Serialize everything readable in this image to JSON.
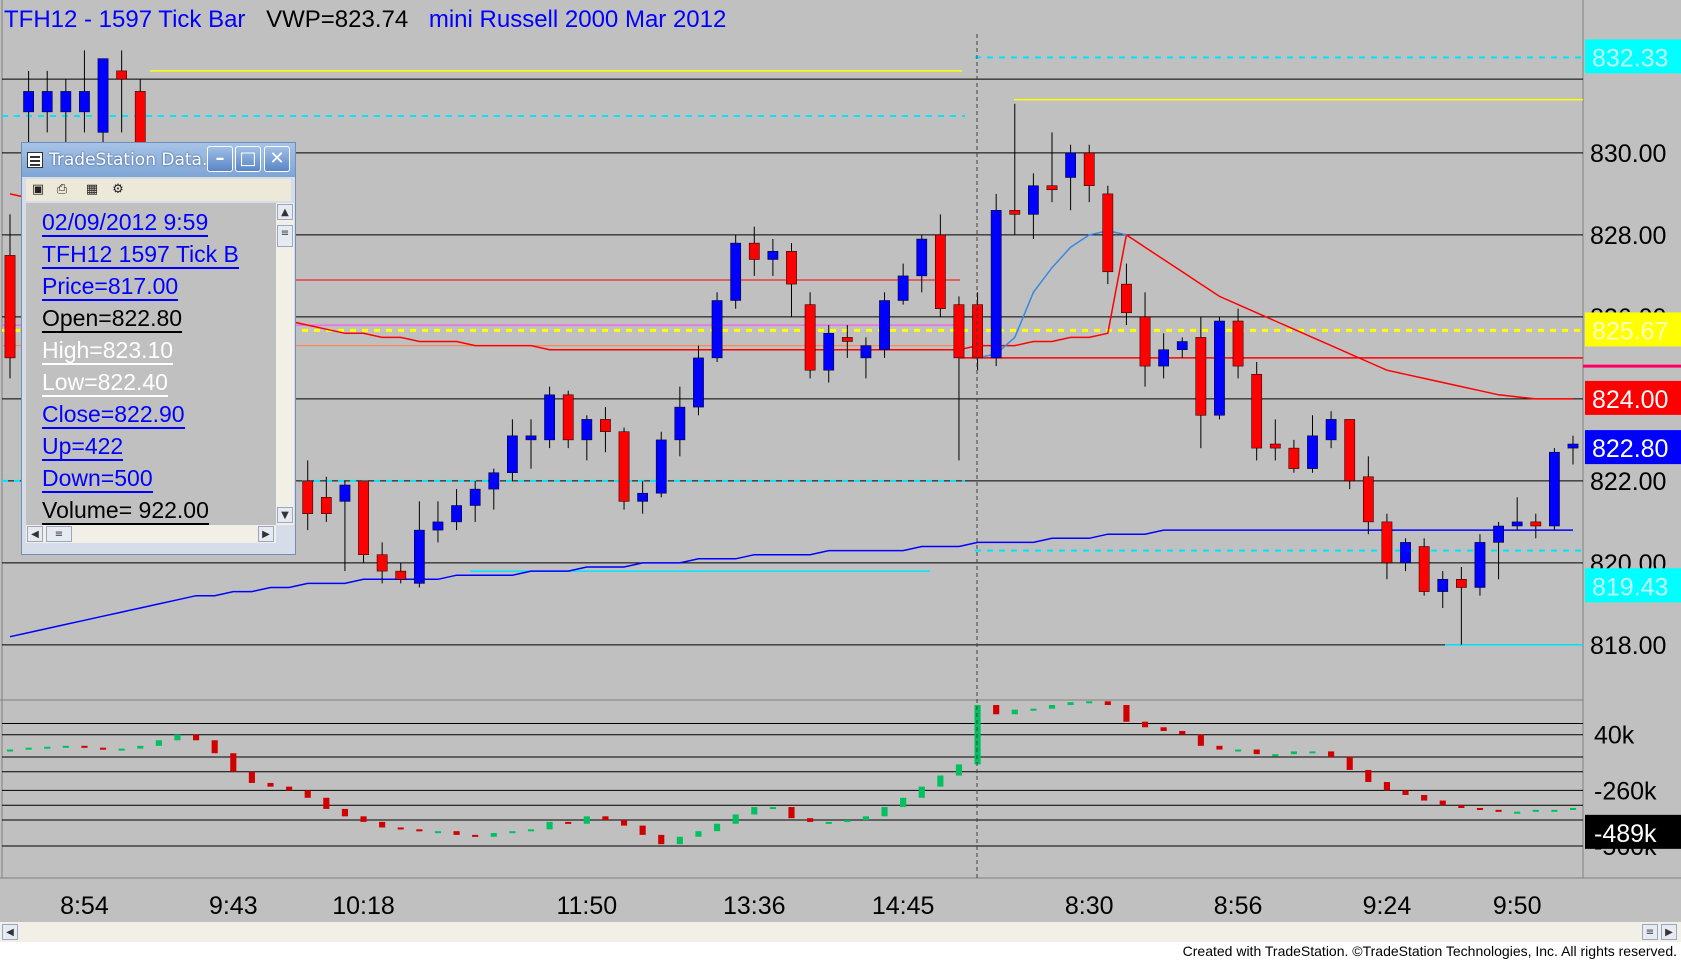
{
  "header": {
    "symbol": "TFH12 - 1597 Tick Bar",
    "vwp": "VWP=823.74",
    "description": "mini Russell 2000 Mar 2012"
  },
  "price_axis": {
    "labels": [
      "830.00",
      "828.00",
      "826.00",
      "824.00",
      "822.00",
      "820.00",
      "818.00"
    ],
    "tags": [
      {
        "text": "832.33",
        "color": "#00ffff"
      },
      {
        "text": "825.67",
        "color": "#ffff00"
      },
      {
        "text": "824.00",
        "color": "#ff0000"
      },
      {
        "text": "822.80",
        "color": "#0000ff"
      },
      {
        "text": "819.43",
        "color": "#00ffff"
      }
    ]
  },
  "volume_axis": {
    "labels": [
      "40k",
      "-260k",
      "-560k"
    ],
    "tag": {
      "text": "-489k",
      "color": "#000000"
    }
  },
  "time_axis": {
    "labels": [
      "8:54",
      "9:43",
      "10:18",
      "11:50",
      "13:36",
      "14:45",
      "8:30",
      "8:56",
      "9:24",
      "9:50"
    ]
  },
  "data_window": {
    "title": "TradeStation Data...",
    "rows": [
      {
        "text": "02/09/2012  9:59",
        "color": "#0000ff"
      },
      {
        "text": "TFH12 1597 Tick B",
        "color": "#0000ff"
      },
      {
        "text": "Price=817.00",
        "color": "#0000ff"
      },
      {
        "text": "Open=822.80",
        "color": "#000000"
      },
      {
        "text": "High=823.10",
        "color": "#ffffff"
      },
      {
        "text": "Low=822.40",
        "color": "#ffffff"
      },
      {
        "text": "Close=822.90",
        "color": "#0000ff"
      },
      {
        "text": "Up=422",
        "color": "#0000ff"
      },
      {
        "text": "Down=500",
        "color": "#0000ff"
      },
      {
        "text": "Volume= 922.00",
        "color": "#000000"
      }
    ]
  },
  "footer": {
    "credit": "Created with TradeStation. ©TradeStation Technologies, Inc. All rights reserved."
  },
  "colors": {
    "background": "#c0c0c0",
    "up_candle": "#0000ff",
    "down_candle": "#ff0000",
    "volume_up": "#00c060",
    "volume_down": "#d00000"
  },
  "chart_data": {
    "type": "candlestick",
    "title": "TFH12 - 1597 Tick Bar  VWP=823.74  mini Russell 2000 Mar 2012",
    "ylim": [
      816.9,
      832.9
    ],
    "session_break_index": 51,
    "candles": [
      {
        "o": 827.5,
        "h": 828.5,
        "l": 824.5,
        "c": 825.0
      },
      {
        "o": 831.0,
        "h": 832.0,
        "l": 830.0,
        "c": 831.5
      },
      {
        "o": 831.0,
        "h": 832.0,
        "l": 830.5,
        "c": 831.5
      },
      {
        "o": 831.0,
        "h": 831.8,
        "l": 830.0,
        "c": 831.5
      },
      {
        "o": 831.0,
        "h": 832.5,
        "l": 830.5,
        "c": 831.5
      },
      {
        "o": 830.5,
        "h": 832.0,
        "l": 830.0,
        "c": 832.3
      },
      {
        "o": 832.0,
        "h": 832.5,
        "l": 830.5,
        "c": 831.8
      },
      {
        "o": 831.5,
        "h": 831.8,
        "l": 828.5,
        "c": 829.0
      },
      {
        "o": 828.5,
        "h": 829.0,
        "l": 826.0,
        "c": 826.5
      },
      {
        "o": 825.5,
        "h": 826.0,
        "l": 824.0,
        "c": 824.5
      },
      {
        "o": 825.5,
        "h": 826.0,
        "l": 823.5,
        "c": 823.8
      },
      {
        "o": 824.0,
        "h": 824.5,
        "l": 822.5,
        "c": 823.0
      },
      {
        "o": 823.8,
        "h": 824.0,
        "l": 822.0,
        "c": 822.6
      },
      {
        "o": 823.5,
        "h": 823.8,
        "l": 822.3,
        "c": 823.0
      },
      {
        "o": 823.2,
        "h": 823.5,
        "l": 821.5,
        "c": 821.8
      },
      {
        "o": 822.5,
        "h": 823.0,
        "l": 821.2,
        "c": 821.5
      },
      {
        "o": 822.0,
        "h": 822.5,
        "l": 820.8,
        "c": 821.2
      },
      {
        "o": 821.6,
        "h": 822.1,
        "l": 821.0,
        "c": 821.2
      },
      {
        "o": 821.5,
        "h": 822.0,
        "l": 819.8,
        "c": 821.9
      },
      {
        "o": 822.0,
        "h": 822.0,
        "l": 820.0,
        "c": 820.2
      },
      {
        "o": 820.2,
        "h": 820.5,
        "l": 819.5,
        "c": 819.8
      },
      {
        "o": 819.8,
        "h": 820.0,
        "l": 819.5,
        "c": 819.6
      },
      {
        "o": 819.5,
        "h": 821.5,
        "l": 819.4,
        "c": 820.8
      },
      {
        "o": 820.8,
        "h": 821.5,
        "l": 820.5,
        "c": 821.0
      },
      {
        "o": 821.0,
        "h": 821.8,
        "l": 820.8,
        "c": 821.4
      },
      {
        "o": 821.4,
        "h": 822.0,
        "l": 821.0,
        "c": 821.8
      },
      {
        "o": 821.8,
        "h": 822.3,
        "l": 821.3,
        "c": 822.2
      },
      {
        "o": 822.2,
        "h": 823.5,
        "l": 822.0,
        "c": 823.1
      },
      {
        "o": 823.0,
        "h": 823.5,
        "l": 822.3,
        "c": 823.1
      },
      {
        "o": 823.0,
        "h": 824.3,
        "l": 822.8,
        "c": 824.1
      },
      {
        "o": 824.1,
        "h": 824.2,
        "l": 822.8,
        "c": 823.0
      },
      {
        "o": 823.0,
        "h": 823.6,
        "l": 822.5,
        "c": 823.5
      },
      {
        "o": 823.5,
        "h": 823.8,
        "l": 822.7,
        "c": 823.2
      },
      {
        "o": 823.2,
        "h": 823.3,
        "l": 821.3,
        "c": 821.5
      },
      {
        "o": 821.5,
        "h": 822.0,
        "l": 821.2,
        "c": 821.7
      },
      {
        "o": 821.7,
        "h": 823.2,
        "l": 821.6,
        "c": 823.0
      },
      {
        "o": 823.0,
        "h": 824.3,
        "l": 822.6,
        "c": 823.8
      },
      {
        "o": 823.8,
        "h": 825.3,
        "l": 823.6,
        "c": 825.0
      },
      {
        "o": 825.0,
        "h": 826.6,
        "l": 824.9,
        "c": 826.4
      },
      {
        "o": 826.4,
        "h": 828.0,
        "l": 826.2,
        "c": 827.8
      },
      {
        "o": 827.8,
        "h": 828.2,
        "l": 827.0,
        "c": 827.4
      },
      {
        "o": 827.4,
        "h": 827.9,
        "l": 827.0,
        "c": 827.6
      },
      {
        "o": 827.6,
        "h": 827.8,
        "l": 826.0,
        "c": 826.8
      },
      {
        "o": 826.3,
        "h": 826.6,
        "l": 824.5,
        "c": 824.7
      },
      {
        "o": 824.7,
        "h": 825.8,
        "l": 824.4,
        "c": 825.6
      },
      {
        "o": 825.5,
        "h": 825.8,
        "l": 825.0,
        "c": 825.4
      },
      {
        "o": 825.0,
        "h": 825.5,
        "l": 824.5,
        "c": 825.3
      },
      {
        "o": 825.2,
        "h": 826.6,
        "l": 825.0,
        "c": 826.4
      },
      {
        "o": 826.4,
        "h": 827.3,
        "l": 826.3,
        "c": 827.0
      },
      {
        "o": 827.0,
        "h": 828.0,
        "l": 826.6,
        "c": 827.9
      },
      {
        "o": 828.0,
        "h": 828.5,
        "l": 826.0,
        "c": 826.2
      },
      {
        "o": 826.3,
        "h": 826.5,
        "l": 822.5,
        "c": 825.0
      },
      {
        "o": 826.3,
        "h": 826.6,
        "l": 824.7,
        "c": 825.0
      },
      {
        "o": 825.0,
        "h": 829.0,
        "l": 824.8,
        "c": 828.6
      },
      {
        "o": 828.6,
        "h": 831.2,
        "l": 828.0,
        "c": 828.5
      },
      {
        "o": 828.5,
        "h": 829.5,
        "l": 827.9,
        "c": 829.2
      },
      {
        "o": 829.2,
        "h": 830.5,
        "l": 828.8,
        "c": 829.1
      },
      {
        "o": 829.4,
        "h": 830.2,
        "l": 828.6,
        "c": 830.0
      },
      {
        "o": 830.0,
        "h": 830.2,
        "l": 828.8,
        "c": 829.2
      },
      {
        "o": 829.0,
        "h": 829.2,
        "l": 826.8,
        "c": 827.1
      },
      {
        "o": 826.8,
        "h": 827.3,
        "l": 825.8,
        "c": 826.1
      },
      {
        "o": 826.0,
        "h": 826.6,
        "l": 824.3,
        "c": 824.8
      },
      {
        "o": 824.8,
        "h": 825.6,
        "l": 824.5,
        "c": 825.2
      },
      {
        "o": 825.2,
        "h": 825.5,
        "l": 825.0,
        "c": 825.4
      },
      {
        "o": 825.5,
        "h": 826.0,
        "l": 822.8,
        "c": 823.6
      },
      {
        "o": 823.6,
        "h": 826.0,
        "l": 823.5,
        "c": 825.9
      },
      {
        "o": 825.9,
        "h": 826.2,
        "l": 824.5,
        "c": 824.8
      },
      {
        "o": 824.6,
        "h": 824.9,
        "l": 822.5,
        "c": 822.8
      },
      {
        "o": 822.9,
        "h": 823.5,
        "l": 822.5,
        "c": 822.8
      },
      {
        "o": 822.8,
        "h": 823.0,
        "l": 822.2,
        "c": 822.3
      },
      {
        "o": 822.3,
        "h": 823.6,
        "l": 822.2,
        "c": 823.1
      },
      {
        "o": 823.0,
        "h": 823.7,
        "l": 822.8,
        "c": 823.5
      },
      {
        "o": 823.5,
        "h": 823.5,
        "l": 821.8,
        "c": 822.0
      },
      {
        "o": 822.1,
        "h": 822.6,
        "l": 820.7,
        "c": 821.0
      },
      {
        "o": 821.0,
        "h": 821.2,
        "l": 819.6,
        "c": 820.0
      },
      {
        "o": 820.0,
        "h": 820.6,
        "l": 819.8,
        "c": 820.5
      },
      {
        "o": 820.4,
        "h": 820.6,
        "l": 819.2,
        "c": 819.3
      },
      {
        "o": 819.3,
        "h": 819.8,
        "l": 818.9,
        "c": 819.6
      },
      {
        "o": 819.6,
        "h": 819.9,
        "l": 818.0,
        "c": 819.4
      },
      {
        "o": 819.4,
        "h": 820.7,
        "l": 819.2,
        "c": 820.5
      },
      {
        "o": 820.5,
        "h": 821.0,
        "l": 819.6,
        "c": 820.9
      },
      {
        "o": 820.9,
        "h": 821.6,
        "l": 820.8,
        "c": 821.0
      },
      {
        "o": 821.0,
        "h": 821.2,
        "l": 820.6,
        "c": 820.9
      },
      {
        "o": 820.9,
        "h": 822.8,
        "l": 820.8,
        "c": 822.7
      },
      {
        "o": 822.8,
        "h": 823.1,
        "l": 822.4,
        "c": 822.9
      }
    ],
    "volume": {
      "ylim": [
        -700,
        200
      ],
      "values": [
        -40,
        -30,
        -25,
        -20,
        -30,
        -40,
        -35,
        -20,
        10,
        40,
        10,
        -60,
        -160,
        -220,
        -240,
        -260,
        -300,
        -360,
        -400,
        -430,
        -460,
        -470,
        -480,
        -480,
        -500,
        -510,
        -490,
        -480,
        -470,
        -430,
        -440,
        -400,
        -420,
        -450,
        -500,
        -550,
        -510,
        -480,
        -440,
        -390,
        -350,
        -350,
        -410,
        -430,
        -430,
        -420,
        -400,
        -350,
        -300,
        -240,
        -180,
        -120,
        200,
        150,
        175,
        180,
        200,
        215,
        220,
        200,
        110,
        80,
        60,
        40,
        -20,
        -40,
        -40,
        -65,
        -65,
        -50,
        -50,
        -80,
        -150,
        -215,
        -260,
        -285,
        -315,
        -340,
        -355,
        -365,
        -375,
        -375,
        -365,
        -365,
        -355
      ]
    },
    "overlays": [
      {
        "name": "",
        "color": "#0000ff",
        "values": [
          818.2,
          818.3,
          818.4,
          818.5,
          818.6,
          818.7,
          818.8,
          818.9,
          819.0,
          819.1,
          819.2,
          819.2,
          819.3,
          819.3,
          819.4,
          819.4,
          819.5,
          819.5,
          819.5,
          819.6,
          819.6,
          819.6,
          819.6,
          819.6,
          819.7,
          819.7,
          819.7,
          819.7,
          819.8,
          819.8,
          819.8,
          819.9,
          819.9,
          819.9,
          820.0,
          820.0,
          820.0,
          820.1,
          820.1,
          820.1,
          820.2,
          820.2,
          820.2,
          820.2,
          820.3,
          820.3,
          820.3,
          820.3,
          820.3,
          820.4,
          820.4,
          820.4,
          820.5,
          820.5,
          820.5,
          820.5,
          820.6,
          820.6,
          820.6,
          820.7,
          820.7,
          820.7,
          820.8,
          820.8,
          820.8,
          820.8,
          820.8,
          820.8,
          820.8,
          820.8,
          820.8,
          820.8,
          820.8,
          820.8,
          820.8,
          820.8,
          820.8,
          820.8,
          820.8,
          820.8,
          820.8,
          820.8,
          820.8,
          820.8,
          820.8
        ]
      },
      {
        "name": "",
        "color": "#ff0000",
        "values": [
          829.0,
          828.9,
          828.8,
          828.7,
          828.5,
          828.3,
          828.1,
          827.9,
          827.6,
          827.3,
          827.0,
          826.7,
          826.4,
          826.2,
          826.0,
          825.9,
          825.8,
          825.7,
          825.6,
          825.6,
          825.5,
          825.5,
          825.4,
          825.4,
          825.4,
          825.3,
          825.3,
          825.3,
          825.3,
          825.2,
          825.2,
          825.2,
          825.2,
          825.2,
          825.2,
          825.2,
          825.2,
          825.2,
          825.2,
          825.2,
          825.2,
          825.2,
          825.2,
          825.2,
          825.2,
          825.2,
          825.2,
          825.2,
          825.2,
          825.2,
          825.2,
          825.2,
          825.3,
          825.3,
          825.3,
          825.4,
          825.4,
          825.5,
          825.5,
          825.6,
          828.0,
          827.7,
          827.4,
          827.1,
          826.8,
          826.5,
          826.3,
          826.1,
          825.9,
          825.7,
          825.5,
          825.3,
          825.1,
          824.9,
          824.7,
          824.6,
          824.5,
          824.4,
          824.3,
          824.2,
          824.1,
          824.05,
          824.0,
          824.0,
          824.0
        ]
      },
      {
        "name": "",
        "color": "#3a88e0",
        "values": [
          null,
          null,
          null,
          null,
          null,
          null,
          null,
          null,
          null,
          null,
          null,
          null,
          null,
          null,
          null,
          null,
          null,
          null,
          null,
          null,
          null,
          null,
          null,
          null,
          null,
          null,
          null,
          null,
          null,
          null,
          null,
          null,
          null,
          null,
          null,
          null,
          null,
          null,
          null,
          null,
          null,
          null,
          null,
          null,
          null,
          null,
          null,
          null,
          null,
          null,
          null,
          null,
          825.0,
          825.1,
          825.5,
          826.6,
          827.2,
          827.7,
          828.0,
          828.1,
          828.0,
          null,
          null,
          null,
          null,
          null,
          null,
          null,
          null,
          null,
          null,
          null,
          null,
          null,
          null,
          null,
          null,
          null,
          null,
          null,
          null,
          null,
          null,
          null,
          null
        ]
      }
    ]
  }
}
